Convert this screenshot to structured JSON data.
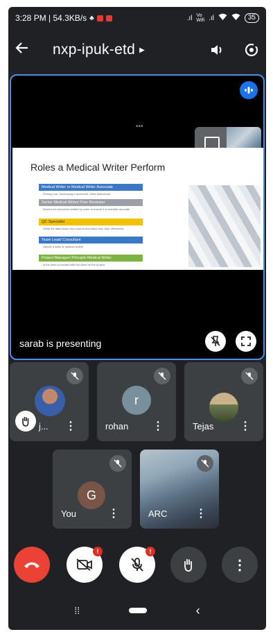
{
  "status_bar": {
    "time_speed": "3:28 PM | 54.3KB/s",
    "battery": "35"
  },
  "header": {
    "meeting_code": "nxp-ipuk-etd"
  },
  "presentation": {
    "presenter_label": "sarab is presenting",
    "slide": {
      "title": "Roles a Medical Writer Perform",
      "roles": [
        {
          "label": "Medical Writer or Medical Writer Associate",
          "note": "Primary role, developing a document, Write Manuscript"
        },
        {
          "label": "Senior Medical Writer/ Peer Reviewer",
          "note": "Review the document written by writer to ensure it is scientific accurate"
        },
        {
          "label": "QC Specialist",
          "note": "Verify the data drawn from source document and other references"
        },
        {
          "label": "Team Lead/ Consultant",
          "note": "Handle a team of medical writers"
        },
        {
          "label": "Project Manager/ Principle Medical Writer",
          "note": "Is the point of contact with the client for the project"
        }
      ]
    }
  },
  "participants": [
    {
      "name": "j...",
      "initial": ""
    },
    {
      "name": "rohan",
      "initial": "r"
    },
    {
      "name": "Tejas",
      "initial": ""
    },
    {
      "name": "You",
      "initial": "G"
    },
    {
      "name": "ARC",
      "initial": ""
    }
  ],
  "colors": {
    "accent": "#1a73e8",
    "end_call": "#ea4335",
    "tile_bg": "#3c4043",
    "screen_bg": "#202124"
  }
}
